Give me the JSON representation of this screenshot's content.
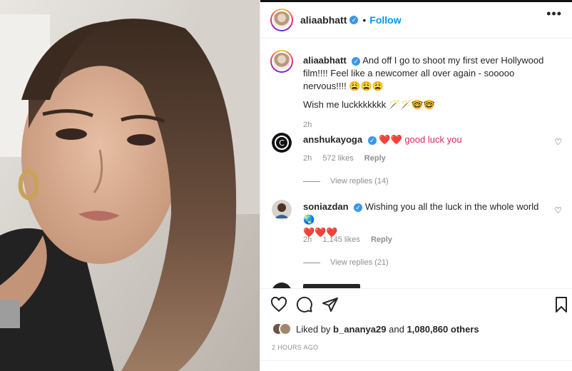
{
  "post": {
    "username": "aliaabhatt",
    "follow_label": "Follow",
    "dot": "•",
    "more_label": "•••"
  },
  "caption": {
    "username": "aliaabhatt",
    "text": "And off I go to shoot my first ever Hollywood film!!!! Feel like a newcomer all over again - sooooo nervous!!!! 😩😩😩",
    "line2": "Wish me luckkkkkkk 🪄🪄🤓🤓",
    "time": "2h"
  },
  "comments": [
    {
      "username": "anshukayoga",
      "text": "❤️❤️ good luck you",
      "time": "2h",
      "likes": "572 likes",
      "reply_label": "Reply",
      "view_replies": "View replies (14)"
    },
    {
      "username": "soniazdan",
      "text": "Wishing you all the luck in the whole world 🌏",
      "text2": "❤️❤️❤️",
      "time": "2h",
      "likes": "1,145 likes",
      "reply_label": "Reply",
      "view_replies": "View replies (21)"
    }
  ],
  "likes_line": {
    "prefix": "Liked by",
    "user": "b_ananya29",
    "mid": "and",
    "count": "1,080,860 others"
  },
  "time_ago": "2 HOURS AGO",
  "icons": [
    "heart-icon",
    "comment-icon",
    "share-icon",
    "bookmark-icon",
    "verified-icon",
    "more-icon"
  ],
  "colors": {
    "accent": "#0095f6",
    "verified": "#3897f0",
    "text": "#262626",
    "muted": "#8e8e8e"
  }
}
